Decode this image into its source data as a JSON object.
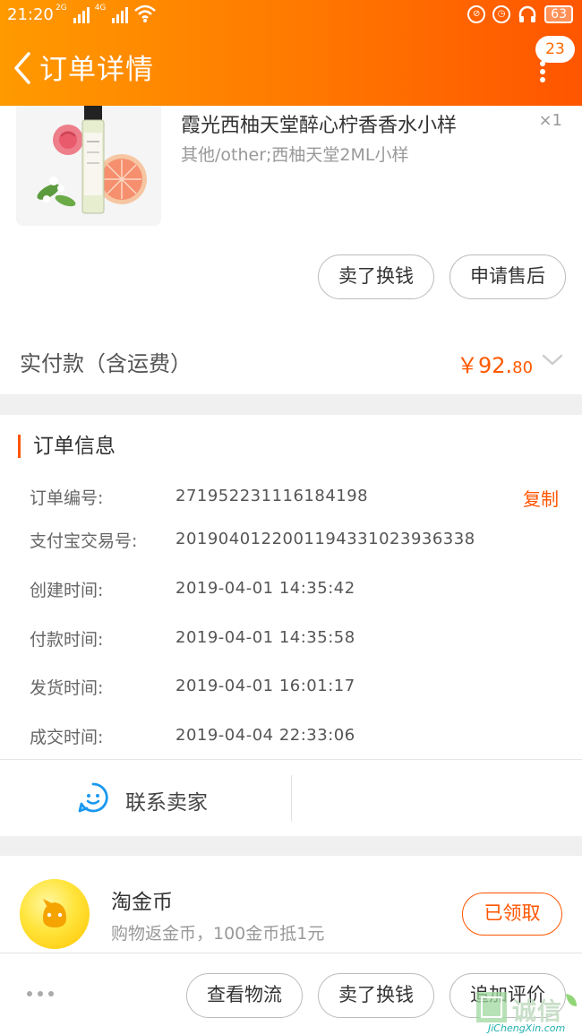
{
  "status_bar": {
    "time": "21:20",
    "net1": "2G",
    "net2": "4G",
    "battery": "63"
  },
  "header": {
    "title": "订单详情",
    "badge_count": "23"
  },
  "product": {
    "name": "霞光西柚天堂醉心柠香香水小样",
    "spec": "其他/other;西柚天堂2ML小样",
    "quantity": "×1",
    "actions": {
      "sell": "卖了换钱",
      "after_sale": "申请售后"
    }
  },
  "payment": {
    "label": "实付款（含运费）",
    "currency": "￥",
    "amount_int": "92.",
    "amount_dec": "80"
  },
  "order_info": {
    "title": "订单信息",
    "copy": "复制",
    "rows": [
      {
        "label": "订单编号:",
        "value": "271952231116184198"
      },
      {
        "label": "支付宝交易号:",
        "value": "2019040122001194331023936338"
      },
      {
        "label": "创建时间:",
        "value": "2019-04-01  14:35:42"
      },
      {
        "label": "付款时间:",
        "value": "2019-04-01  14:35:58"
      },
      {
        "label": "发货时间:",
        "value": "2019-04-01  16:01:17"
      },
      {
        "label": "成交时间:",
        "value": "2019-04-04  22:33:06"
      }
    ],
    "contact": "联系卖家"
  },
  "coin": {
    "title": "淘金币",
    "subtitle": "购物返金币，100金币抵1元",
    "button": "已领取"
  },
  "bottom_bar": {
    "logistics": "查看物流",
    "sell": "卖了换钱",
    "review": "追加评价"
  },
  "watermark": {
    "text": "诚信",
    "url": "JiChengXin.com"
  },
  "colors": {
    "accent": "#ff5500",
    "header_start": "#ff9a00",
    "header_end": "#ff5500"
  }
}
